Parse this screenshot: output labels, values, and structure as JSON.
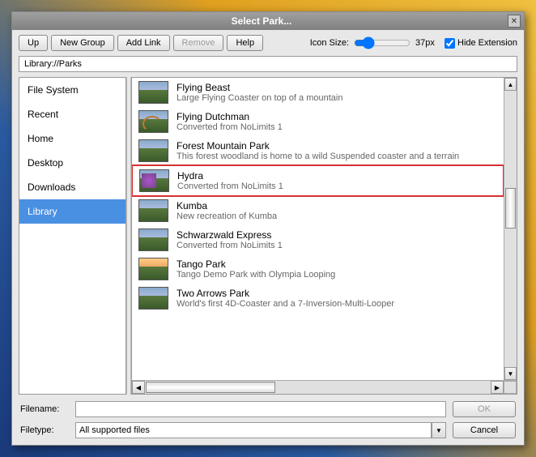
{
  "window": {
    "title": "Select Park..."
  },
  "toolbar": {
    "up": "Up",
    "new_group": "New Group",
    "add_link": "Add Link",
    "remove": "Remove",
    "help": "Help",
    "icon_size_label": "Icon Size:",
    "icon_size_value": "37px",
    "hide_extension_label": "Hide Extension",
    "hide_extension_checked": true
  },
  "path": {
    "value": "Library://Parks"
  },
  "sidebar": {
    "items": [
      {
        "label": "File System",
        "selected": false
      },
      {
        "label": "Recent",
        "selected": false
      },
      {
        "label": "Home",
        "selected": false
      },
      {
        "label": "Desktop",
        "selected": false
      },
      {
        "label": "Downloads",
        "selected": false
      },
      {
        "label": "Library",
        "selected": true
      }
    ]
  },
  "parks": [
    {
      "title": "Flying Beast",
      "desc": "Large Flying Coaster on top of a mountain",
      "highlighted": false
    },
    {
      "title": "Flying Dutchman",
      "desc": "Converted from NoLimits 1",
      "highlighted": false
    },
    {
      "title": "Forest Mountain Park",
      "desc": "This forest woodland is home to a wild Suspended coaster and a terrain",
      "highlighted": false
    },
    {
      "title": "Hydra",
      "desc": "Converted from NoLimits 1",
      "highlighted": true
    },
    {
      "title": "Kumba",
      "desc": "New recreation of Kumba",
      "highlighted": false
    },
    {
      "title": "Schwarzwald Express",
      "desc": "Converted from NoLimits 1",
      "highlighted": false
    },
    {
      "title": "Tango Park",
      "desc": "Tango Demo Park with Olympia Looping",
      "highlighted": false
    },
    {
      "title": "Two Arrows Park",
      "desc": "World's first 4D-Coaster and a 7-Inversion-Multi-Looper",
      "highlighted": false
    }
  ],
  "footer": {
    "filename_label": "Filename:",
    "filename_value": "",
    "filetype_label": "Filetype:",
    "filetype_value": "All supported files",
    "ok_label": "OK",
    "cancel_label": "Cancel"
  }
}
